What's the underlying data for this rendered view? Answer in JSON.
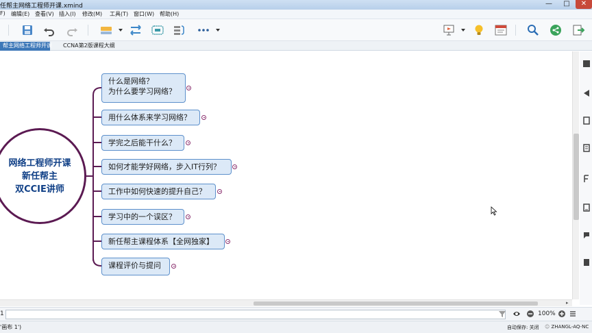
{
  "window": {
    "title": "任帮主网络工程师开课.xmind",
    "controls": [
      "—",
      "□",
      "✕"
    ]
  },
  "menu": [
    "F)",
    "编辑(E)",
    "查看(V)",
    "插入(I)",
    "修改(M)",
    "工具(T)",
    "窗口(W)",
    "帮助(H)"
  ],
  "toolbar": {
    "icons": [
      "save-icon",
      "undo-icon",
      "redo-icon",
      "topic-icon",
      "relationship-icon",
      "boundary-icon",
      "summary-icon",
      "more-icon",
      "presentation-icon",
      "idea-icon",
      "layout-icon",
      "search-icon",
      "share-icon",
      "export-icon"
    ]
  },
  "tabs": [
    {
      "label": "帮主网络工程师开课",
      "active": true
    },
    {
      "label": "CCNA第2版课程大纲",
      "active": false
    }
  ],
  "mindmap": {
    "central": {
      "lines": [
        "网络工程师开课",
        "新任帮主",
        "双CCIE讲师"
      ]
    },
    "branches": [
      {
        "lines": [
          "什么是网络？",
          "为什么要学习网络？"
        ]
      },
      {
        "lines": [
          "用什么体系来学习网络？"
        ]
      },
      {
        "lines": [
          "学完之后能干什么？"
        ]
      },
      {
        "lines": [
          "如何才能学好网络，步入IT行列？"
        ]
      },
      {
        "lines": [
          "工作中如何快速的提升自己？"
        ]
      },
      {
        "lines": [
          "学习中的一个误区？"
        ]
      },
      {
        "lines": [
          "新任帮主课程体系【全网独家】"
        ]
      },
      {
        "lines": [
          "课程评价与提问"
        ]
      }
    ],
    "colors": {
      "central_border": "#5b1a52",
      "central_text": "#0f3f86",
      "topic_fill": "#dce9f7",
      "topic_border": "#5c8fcb",
      "connector": "#5b1a52"
    }
  },
  "findbar": {
    "number": "1",
    "search_placeholder": "",
    "zoom": "100%"
  },
  "statusbar": {
    "left": "'画布 1')",
    "autosave": "自动保存: 关闭",
    "host": "ZHANGL-AQ-NC"
  }
}
